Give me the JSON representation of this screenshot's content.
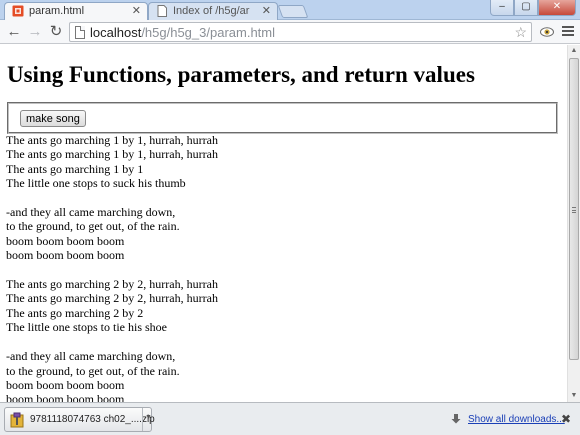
{
  "tabs": [
    {
      "label": "param.html",
      "active": true
    },
    {
      "label": "Index of /h5g/ar",
      "active": false
    }
  ],
  "window_controls": {
    "minimize": "–",
    "maximize": "▢",
    "close": "✕"
  },
  "address_bar": {
    "host": "localhost",
    "path": "/h5g/h5g_3/param.html"
  },
  "page": {
    "title": "Using Functions, parameters, and return values",
    "button_label": "make song",
    "song_lines": [
      "The ants go marching 1 by 1, hurrah, hurrah",
      "The ants go marching 1 by 1, hurrah, hurrah",
      "The ants go marching 1 by 1",
      "The little one stops to suck his thumb",
      "",
      "-and they all came marching down,",
      "to the ground, to get out, of the rain.",
      "boom boom boom boom",
      "boom boom boom boom",
      "",
      "The ants go marching 2 by 2, hurrah, hurrah",
      "The ants go marching 2 by 2, hurrah, hurrah",
      "The ants go marching 2 by 2",
      "The little one stops to tie his shoe",
      "",
      "-and they all came marching down,",
      "to the ground, to get out, of the rain.",
      "boom boom boom boom",
      "boom boom boom boom"
    ]
  },
  "download_shelf": {
    "file_name": "9781118074763 ch02_....zip",
    "show_all_label": "Show all downloads..."
  },
  "icons": {
    "tab_favicon": "html5-icon",
    "back": "back-arrow-icon",
    "forward": "forward-arrow-icon",
    "reload": "reload-icon",
    "bookmark": "star-icon",
    "extension": "eye-icon",
    "menu": "hamburger-menu-icon"
  },
  "colors": {
    "accent_link": "#1a3fb6",
    "favicon": "#e44d26",
    "tabstrip": "#bcd2ee"
  }
}
